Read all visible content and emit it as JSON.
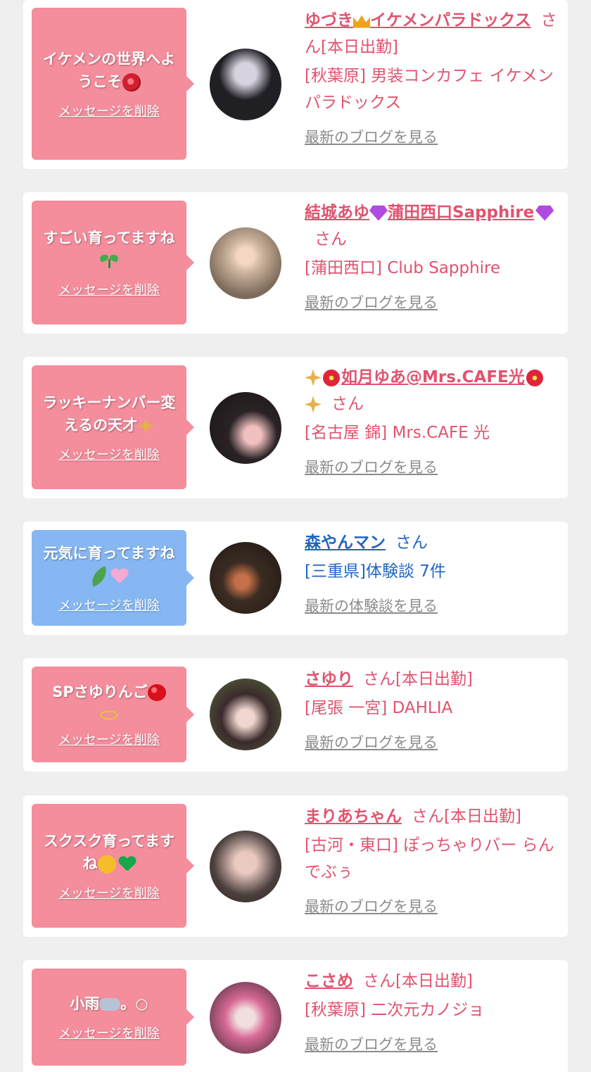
{
  "colors": {
    "page_bg": "#efefef",
    "card_bg": "#ffffff",
    "bubble_pink": "#f48d9c",
    "bubble_blue": "#86b7f3",
    "name_pink": "#e0536f",
    "name_blue": "#1f66c2",
    "link_gray": "#8b8b8b"
  },
  "items": [
    {
      "bubble_color": "pink",
      "message": "イケメンの世界へようこそ",
      "message_icons": [
        "rose-icon"
      ],
      "delete_label": "メッセージを削除",
      "avatar_icon": "profile-photo",
      "name": "ゆづき",
      "name_icon": "crown-icon",
      "name_tail": "イケメンパラドックス",
      "san": "さん",
      "status": "[本日出勤]",
      "shop": "[秋葉原] 男装コンカフェ イケメンパラドックス",
      "link": "最新のブログを見る"
    },
    {
      "bubble_color": "pink",
      "message": "すごい育ってますね",
      "message_icons": [
        "sprout-icon"
      ],
      "delete_label": "メッセージを削除",
      "avatar_icon": "profile-photo",
      "name": "結城あゆ",
      "name_icon": "gem-icon",
      "name_tail": "蒲田西口Sapphire",
      "name_icon_end": "gem-icon",
      "san": "さん",
      "status": "",
      "shop": "[蒲田西口] Club Sapphire",
      "link": "最新のブログを見る"
    },
    {
      "bubble_color": "pink",
      "message": "ラッキーナンバー変えるの天才",
      "message_icons": [
        "sparkle-icon"
      ],
      "delete_label": "メッセージを削除",
      "avatar_icon": "profile-photo",
      "name": "如月ゆあ@Mrs.CAFE光",
      "name_lead_icons": [
        "sparkle-icon",
        "hibiscus-icon"
      ],
      "name_end_icons": [
        "hibiscus-icon",
        "sparkle-icon"
      ],
      "san": "さん",
      "status": "",
      "shop": "[名古屋 錦] Mrs.CAFE 光",
      "link": "最新のブログを見る"
    },
    {
      "bubble_color": "blue",
      "message": "元気に育ってますね",
      "message_icons": [
        "leaf-icon",
        "pink-heart-icon"
      ],
      "delete_label": "メッセージを削除",
      "avatar_icon": "profile-photo",
      "name": "森やんマン",
      "san": "さん",
      "status": "",
      "shop": "[三重県]体験談 7件",
      "link": "最新の体験談を見る"
    },
    {
      "bubble_color": "pink",
      "message": "SPさゆりんご",
      "message_icons": [
        "apple-icon",
        "ring-icon"
      ],
      "delete_label": "メッセージを削除",
      "avatar_icon": "profile-photo",
      "name": "さゆり",
      "san": "さん",
      "status": "[本日出勤]",
      "shop": "[尾張 一宮] DAHLIA",
      "link": "最新のブログを見る"
    },
    {
      "bubble_color": "pink",
      "message": "スクスク育ってますね",
      "message_icons": [
        "smiling-face-icon",
        "green-heart-icon"
      ],
      "delete_label": "メッセージを削除",
      "avatar_icon": "profile-photo",
      "name": "まりあちゃん",
      "san": "さん",
      "status": "[本日出勤]",
      "shop": "[古河・東口] ぽっちゃりバー らんでぶぅ",
      "link": "最新のブログを見る"
    },
    {
      "bubble_color": "pink",
      "message": "小雨",
      "message_icons": [
        "rain-cloud-icon"
      ],
      "message_tail": "。○",
      "delete_label": "メッセージを削除",
      "avatar_icon": "profile-photo",
      "name": "こさめ",
      "san": "さん",
      "status": "[本日出勤]",
      "shop": "[秋葉原] 二次元カノジョ",
      "link": "最新のブログを見る"
    }
  ]
}
